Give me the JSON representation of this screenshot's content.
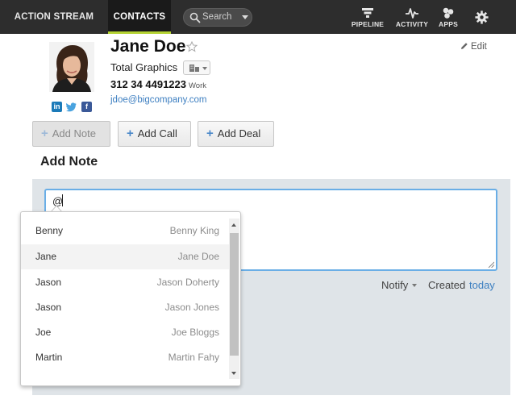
{
  "nav": {
    "tabs": [
      {
        "label": "ACTION STREAM"
      },
      {
        "label": "CONTACTS",
        "active": true
      }
    ],
    "search_placeholder": "Search",
    "icons": [
      {
        "label": "PIPELINE",
        "icon": "pipeline-icon"
      },
      {
        "label": "ACTIVITY",
        "icon": "activity-icon"
      },
      {
        "label": "APPS",
        "icon": "apps-icon"
      },
      {
        "icon": "gear-icon"
      }
    ],
    "active_accent": "#b5d334",
    "background": "#2d2d2d"
  },
  "contact": {
    "name": "Jane Doe",
    "company": "Total Graphics",
    "phone": "312 34 4491223",
    "phone_type": "Work",
    "email": "jdoe@bigcompany.com",
    "social": [
      "linkedin-icon",
      "twitter-icon",
      "facebook-icon"
    ],
    "edit_label": "Edit"
  },
  "actions": [
    {
      "label": "Add Note",
      "active": true
    },
    {
      "label": "Add Call"
    },
    {
      "label": "Add Deal"
    }
  ],
  "note": {
    "title": "Add Note",
    "value": "@",
    "notify_label": "Notify",
    "created_label": "Created",
    "created_value": "today"
  },
  "mention_dropdown": {
    "items": [
      {
        "first": "Benny",
        "full": "Benny King"
      },
      {
        "first": "Jane",
        "full": "Jane Doe",
        "highlighted": true
      },
      {
        "first": "Jason",
        "full": "Jason Doherty"
      },
      {
        "first": "Jason",
        "full": "Jason Jones"
      },
      {
        "first": "Joe",
        "full": "Joe Bloggs"
      },
      {
        "first": "Martin",
        "full": "Martin Fahy"
      }
    ]
  },
  "colors": {
    "link": "#3d7fc1",
    "panel": "#dfe4e8",
    "focus_border": "#6aaee6"
  }
}
